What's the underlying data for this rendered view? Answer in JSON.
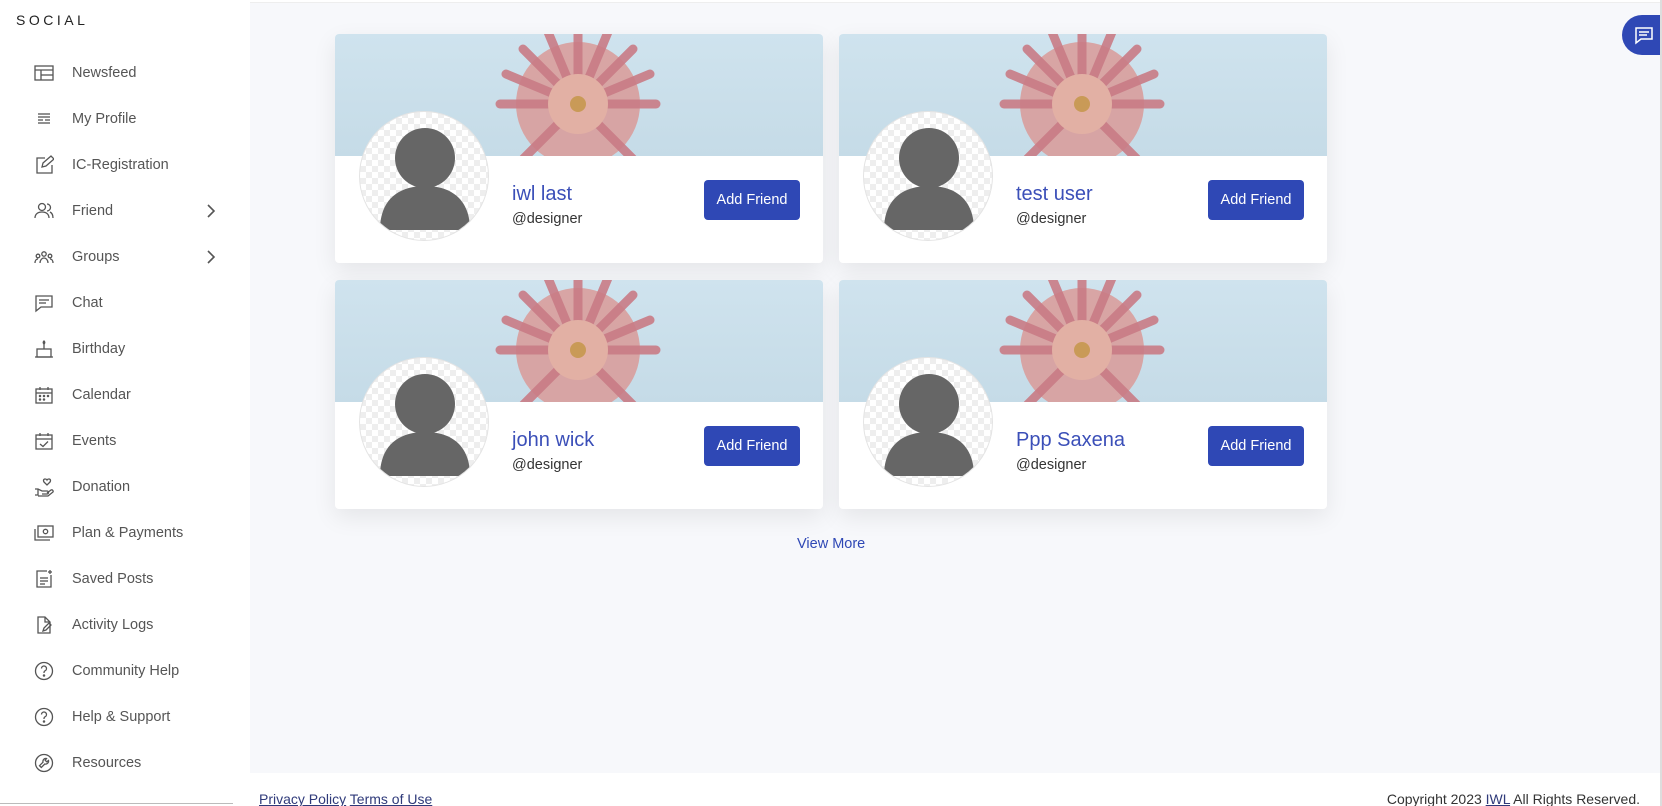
{
  "brand": "SOCIAL",
  "sidebar": {
    "items": [
      {
        "label": "Newsfeed",
        "icon": "newsfeed-icon"
      },
      {
        "label": "My Profile",
        "icon": "profile-icon"
      },
      {
        "label": "IC-Registration",
        "icon": "edit-icon"
      },
      {
        "label": "Friend",
        "icon": "friends-icon",
        "expandable": true
      },
      {
        "label": "Groups",
        "icon": "groups-icon",
        "expandable": true
      },
      {
        "label": "Chat",
        "icon": "chat-icon"
      },
      {
        "label": "Birthday",
        "icon": "cake-icon"
      },
      {
        "label": "Calendar",
        "icon": "calendar-icon"
      },
      {
        "label": "Events",
        "icon": "events-icon"
      },
      {
        "label": "Donation",
        "icon": "donation-icon"
      },
      {
        "label": "Plan & Payments",
        "icon": "payments-icon"
      },
      {
        "label": "Saved Posts",
        "icon": "saved-posts-icon"
      },
      {
        "label": "Activity Logs",
        "icon": "activity-log-icon"
      },
      {
        "label": "Community Help",
        "icon": "help-circle-icon"
      },
      {
        "label": "Help & Support",
        "icon": "help-circle-icon"
      },
      {
        "label": "Resources",
        "icon": "wrench-icon"
      }
    ]
  },
  "cards": [
    {
      "name": "iwl last",
      "handle": "@designer",
      "button": "Add Friend"
    },
    {
      "name": "test user",
      "handle": "@designer",
      "button": "Add Friend"
    },
    {
      "name": "john wick",
      "handle": "@designer",
      "button": "Add Friend"
    },
    {
      "name": "Ppp Saxena",
      "handle": "@designer",
      "button": "Add Friend"
    }
  ],
  "view_more": "View More",
  "footer": {
    "privacy": "Privacy Policy",
    "terms": "Terms of Use",
    "copyright_prefix": "Copyright 2023",
    "copyright_link": "IWL",
    "copyright_suffix": "All Rights Reserved."
  },
  "colors": {
    "accent": "#2f48b5",
    "link": "#3b4fb8",
    "background": "#f7f8fb"
  }
}
